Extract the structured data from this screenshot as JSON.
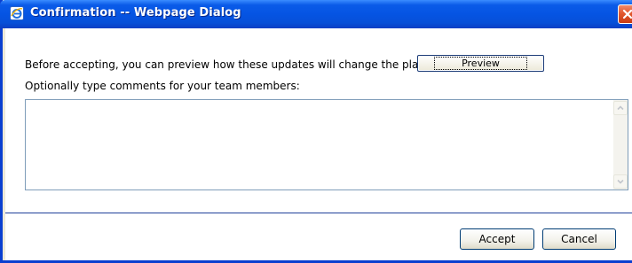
{
  "dialog": {
    "title": "Confirmation -- Webpage Dialog",
    "icon": "internet-explorer-icon",
    "close_icon": "close-icon"
  },
  "content": {
    "preview_prompt": "Before accepting, you can preview how these updates will change the plan:",
    "preview_button": "Preview",
    "comments_label": "Optionally type comments for your team members:",
    "comments_value": ""
  },
  "footer": {
    "accept_button": "Accept",
    "cancel_button": "Cancel"
  },
  "colors": {
    "titlebar": "#0554e3",
    "frame": "#0a3fd0",
    "close_button": "#e2582f",
    "divider": "#1f3f99"
  }
}
